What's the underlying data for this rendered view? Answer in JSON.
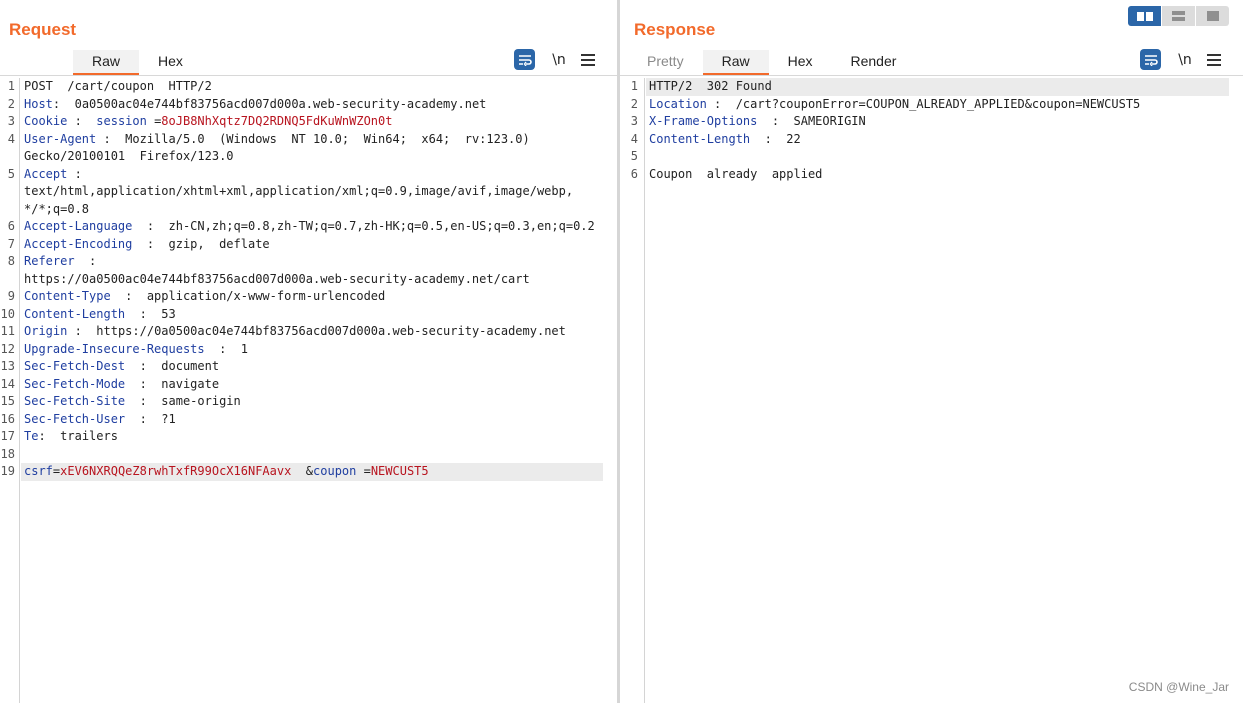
{
  "request": {
    "title": "Request",
    "tabs": [
      "Raw",
      "Hex"
    ],
    "active_tab": "Raw",
    "tool_newline_label": "\\n",
    "lines": [
      {
        "n": "1",
        "plain": "POST  /cart/coupon  HTTP/2"
      },
      {
        "n": "2",
        "key": "Host",
        "sep": ":  ",
        "val": "0a0500ac04e744bf83756acd007d000a.web-security-academy.net"
      },
      {
        "n": "3",
        "key": "Cookie",
        "sep": " :  ",
        "subkey": "session",
        "subsep": " =",
        "cval": "8oJB8NhXqtz7DQ2RDNQ5FdKuWnWZOn0t"
      },
      {
        "n": "4",
        "key": "User-Agent",
        "sep": " :  ",
        "val": "Mozilla/5.0  (Windows  NT 10.0;  Win64;  x64;  rv:123.0)"
      },
      {
        "n": "",
        "plain": "Gecko/20100101  Firefox/123.0"
      },
      {
        "n": "5",
        "key": "Accept",
        "sep": " :"
      },
      {
        "n": "",
        "plain": "text/html,application/xhtml+xml,application/xml;q=0.9,image/avif,image/webp,"
      },
      {
        "n": "",
        "plain": "*/*;q=0.8"
      },
      {
        "n": "6",
        "key": "Accept-Language",
        "sep": "  :  ",
        "val": "zh-CN,zh;q=0.8,zh-TW;q=0.7,zh-HK;q=0.5,en-US;q=0.3,en;q=0.2"
      },
      {
        "n": "7",
        "key": "Accept-Encoding",
        "sep": "  :  ",
        "val": "gzip,  deflate"
      },
      {
        "n": "8",
        "key": "Referer",
        "sep": "  :"
      },
      {
        "n": "",
        "plain": "https://0a0500ac04e744bf83756acd007d000a.web-security-academy.net/cart"
      },
      {
        "n": "9",
        "key": "Content-Type",
        "sep": "  :  ",
        "val": "application/x-www-form-urlencoded"
      },
      {
        "n": "10",
        "key": "Content-Length",
        "sep": "  :  ",
        "val": "53"
      },
      {
        "n": "11",
        "key": "Origin",
        "sep": " :  ",
        "val": "https://0a0500ac04e744bf83756acd007d000a.web-security-academy.net"
      },
      {
        "n": "12",
        "key": "Upgrade-Insecure-Requests",
        "sep": "  :  ",
        "val": "1"
      },
      {
        "n": "13",
        "key": "Sec-Fetch-Dest",
        "sep": "  :  ",
        "val": "document"
      },
      {
        "n": "14",
        "key": "Sec-Fetch-Mode",
        "sep": "  :  ",
        "val": "navigate"
      },
      {
        "n": "15",
        "key": "Sec-Fetch-Site",
        "sep": "  :  ",
        "val": "same-origin"
      },
      {
        "n": "16",
        "key": "Sec-Fetch-User",
        "sep": "  :  ",
        "val": "?1"
      },
      {
        "n": "17",
        "key": "Te",
        "sep": ":  ",
        "val": "trailers"
      },
      {
        "n": "18",
        "plain": ""
      },
      {
        "n": "19",
        "highlight": true,
        "params": [
          {
            "k": "csrf",
            "eq": "=",
            "v": "xEV6NXRQQeZ8rwhTxfR99OcX16NFAavx"
          },
          {
            "amp": "  &",
            "k": "coupon",
            "eq": " =",
            "v": "NEWCUST5"
          }
        ]
      }
    ]
  },
  "response": {
    "title": "Response",
    "tabs": [
      "Pretty",
      "Raw",
      "Hex",
      "Render"
    ],
    "active_tab": "Raw",
    "tool_newline_label": "\\n",
    "lines": [
      {
        "n": "1",
        "highlight": true,
        "plain": "HTTP/2  302 Found"
      },
      {
        "n": "2",
        "key": "Location",
        "sep": " :  ",
        "val": "/cart?couponError=COUPON_ALREADY_APPLIED&coupon=NEWCUST5"
      },
      {
        "n": "3",
        "key": "X-Frame-Options",
        "sep": "  :  ",
        "val": "SAMEORIGIN"
      },
      {
        "n": "4",
        "key": "Content-Length",
        "sep": "  :  ",
        "val": "22"
      },
      {
        "n": "5",
        "plain": ""
      },
      {
        "n": "6",
        "plain": "Coupon  already  applied"
      }
    ]
  },
  "layout_toggles": [
    "split-horizontal-icon",
    "split-vertical-icon",
    "single-pane-icon"
  ],
  "watermark": "CSDN @Wine_Jar",
  "colors": {
    "accent": "#f26a2b",
    "header_key": "#1f3ea0",
    "value_red": "#b8141f",
    "toggle_active": "#2b66a8"
  }
}
